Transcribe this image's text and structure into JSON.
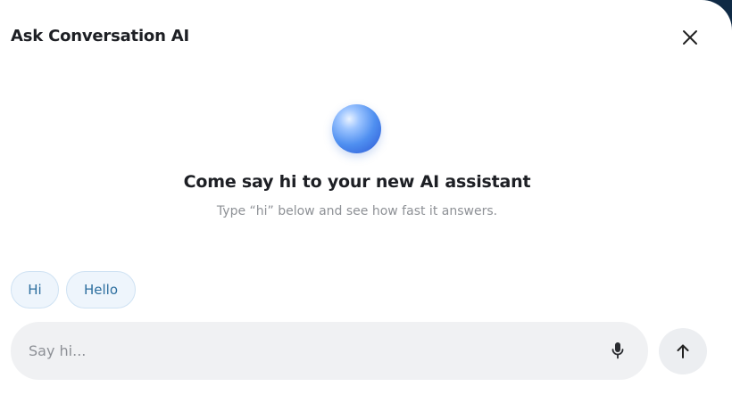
{
  "dialog": {
    "title": "Ask Conversation AI",
    "close_icon": "close-icon"
  },
  "welcome": {
    "orb_icon": "assistant-orb-icon",
    "heading": "Come say hi to your new AI assistant",
    "subheading": "Type “hi” below and see how fast it answers."
  },
  "suggestions": [
    {
      "label": "Hi"
    },
    {
      "label": "Hello"
    }
  ],
  "composer": {
    "placeholder": "Say hi...",
    "value": "",
    "mic_icon": "microphone-icon",
    "send_icon": "arrow-up-icon"
  },
  "colors": {
    "chip_text": "#2d6f9f",
    "chip_bg": "#eef5fc",
    "input_bg": "#f0f1f3",
    "orb": "#4f8ff0"
  }
}
